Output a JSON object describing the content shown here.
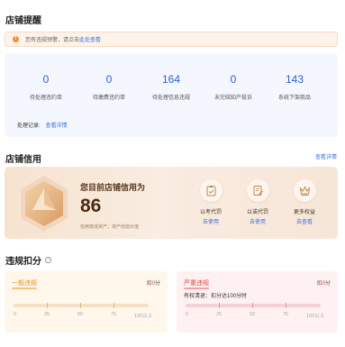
{
  "shop_alert": {
    "title": "店铺提醒",
    "alert_icon": "!",
    "alert_text": "您有违规预警，请点击",
    "alert_link": "此处查看",
    "stats": [
      {
        "value": "0",
        "label": "待处理违约单"
      },
      {
        "value": "0",
        "label": "待缴费违约单"
      },
      {
        "value": "164",
        "label": "待处理信息违规"
      },
      {
        "value": "0",
        "label": "未完结知产投诉"
      },
      {
        "value": "143",
        "label": "系统下架商品"
      }
    ],
    "record_label": "处理记录:",
    "record_link": "查看详情"
  },
  "shop_credit": {
    "title": "店铺信用",
    "view_detail": "查看详情",
    "caption": "您目前店铺信用为",
    "score": "86",
    "description": "信用变成资产，资产创造价值",
    "actions": [
      {
        "icon": "clipboard-check-icon",
        "label": "以考代罚",
        "link": "去使用"
      },
      {
        "icon": "document-edit-icon",
        "label": "以诺代罚",
        "link": "去使用"
      },
      {
        "icon": "crown-icon",
        "label": "更多权益",
        "link": "去查看"
      }
    ]
  },
  "violation_deduction": {
    "title": "违规扣分",
    "help_icon": "?",
    "general": {
      "tag": "一般违规",
      "score_prefix": "扣",
      "score_value": "0",
      "score_suffix": "分",
      "scale": [
        "0",
        "25",
        "50",
        "75",
        "100以上"
      ],
      "accent_color": "#f5a43c"
    },
    "serious": {
      "tag": "严重违规",
      "score_prefix": "扣",
      "score_value": "0",
      "score_suffix": "分",
      "subtitle": "有权清退：扣分达100分时",
      "scale": [
        "0",
        "25",
        "50",
        "75",
        "100以上"
      ],
      "accent_color": "#e04545"
    }
  }
}
